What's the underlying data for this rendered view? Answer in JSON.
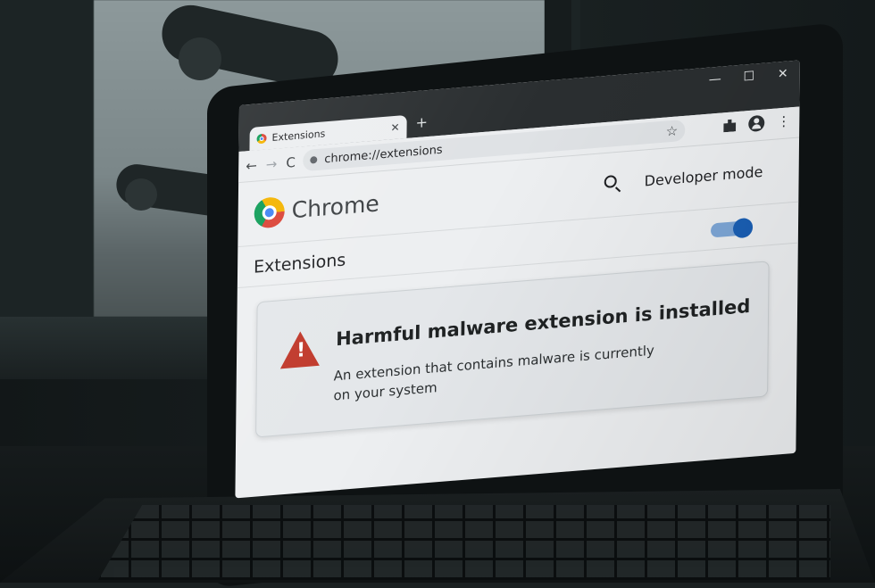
{
  "window_controls": {
    "minimize": "—",
    "maximize": "☐",
    "close": "✕"
  },
  "tab": {
    "title": "Extensions",
    "close": "✕"
  },
  "new_tab": "+",
  "toolbar": {
    "back": "←",
    "forward": "→",
    "reload": "C",
    "url": "chrome://extensions",
    "bookmark": "☆",
    "menu": "⋮"
  },
  "header": {
    "brand": "Chrome",
    "developer_mode_label": "Developer mode"
  },
  "extensions_bar": {
    "title": "Extensions",
    "developer_mode_on": true
  },
  "alert": {
    "title": "Harmful malware extension is installed",
    "description": "An extension that contains malware is currently on your system",
    "icon_mark": "!"
  },
  "colors": {
    "accent": "#1a5fb4",
    "warning": "#c0392b",
    "chrome_red": "#db4437",
    "chrome_yellow": "#f4b400",
    "chrome_green": "#0f9d58",
    "chrome_blue": "#4285f4"
  },
  "icons": [
    "search-icon",
    "star-icon",
    "puzzle-icon",
    "profile-icon",
    "warning-icon"
  ]
}
